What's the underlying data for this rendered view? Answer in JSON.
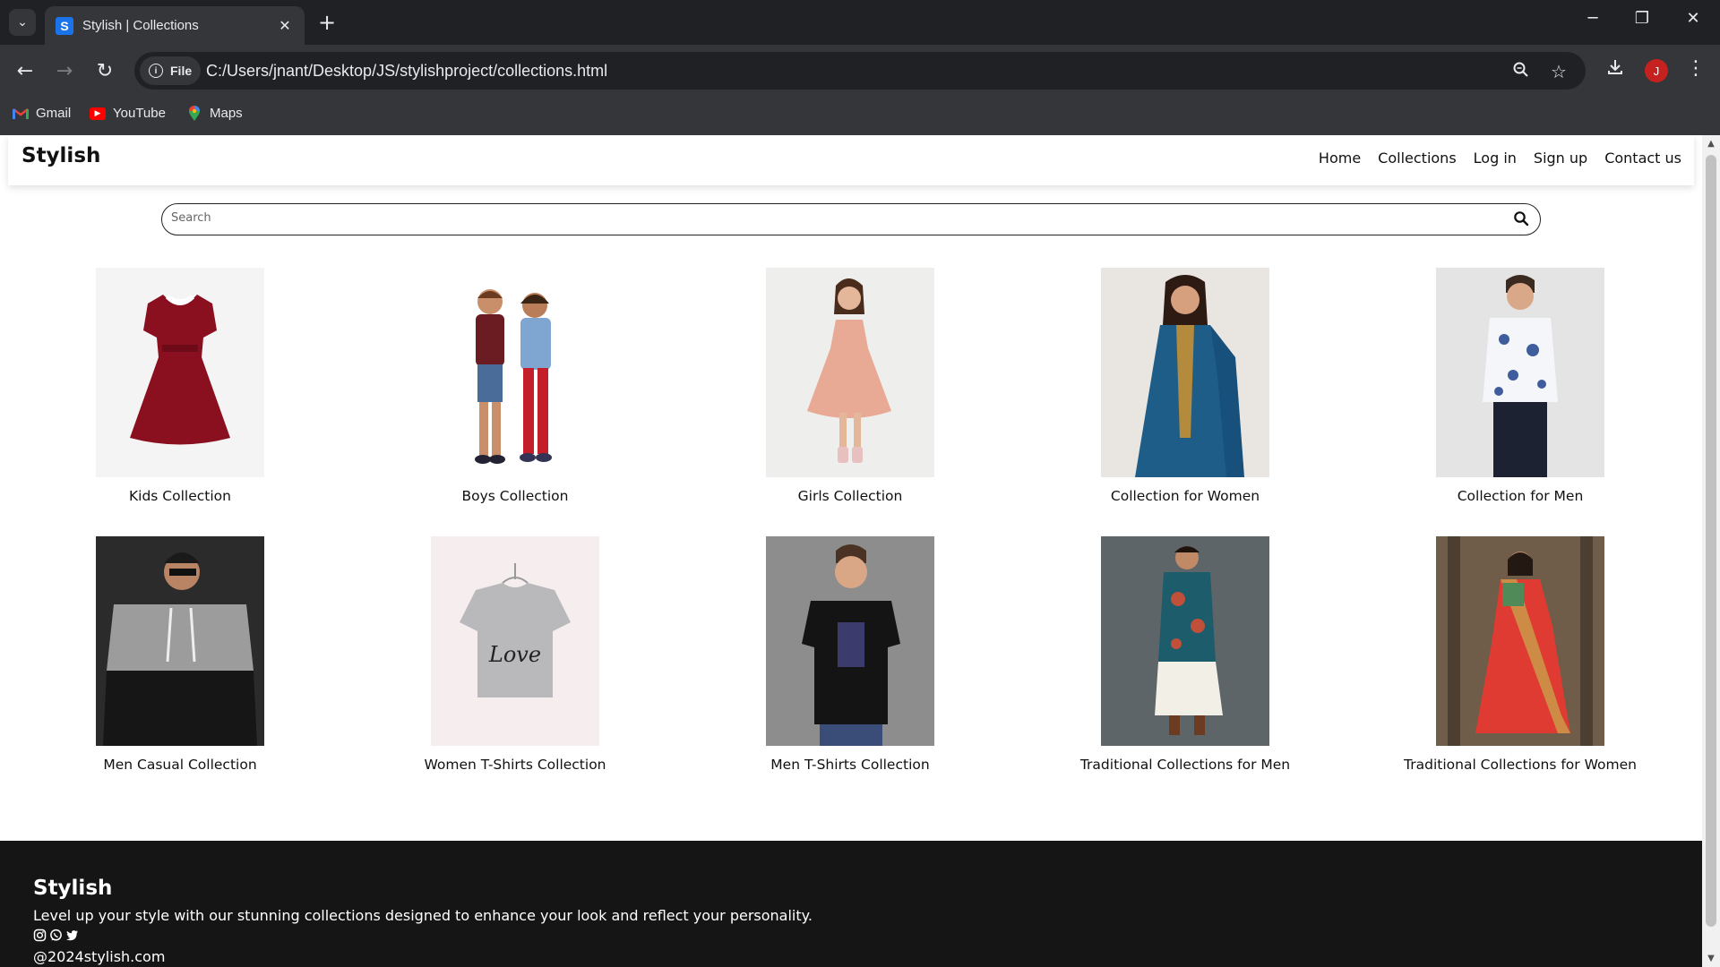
{
  "browser": {
    "tab_title": "Stylish | Collections",
    "favicon_letter": "S",
    "url_chip": "File",
    "url": "C:/Users/jnant/Desktop/JS/stylishproject/collections.html",
    "profile_initial": "J",
    "bookmarks": [
      {
        "label": "Gmail",
        "icon": "gmail-icon"
      },
      {
        "label": "YouTube",
        "icon": "youtube-icon"
      },
      {
        "label": "Maps",
        "icon": "maps-icon"
      }
    ]
  },
  "site": {
    "brand": "Stylish",
    "nav": [
      "Home",
      "Collections",
      "Log in",
      "Sign up",
      "Contact us"
    ],
    "search_placeholder": "Search",
    "collections": [
      {
        "label": "Kids Collection",
        "image": "red velvet kids dress"
      },
      {
        "label": "Boys Collection",
        "image": "two boys"
      },
      {
        "label": "Girls Collection",
        "image": "girl in pink sequin dress"
      },
      {
        "label": "Collection for Women",
        "image": "woman in blue kurta"
      },
      {
        "label": "Collection for Men",
        "image": "man in floral shirt"
      },
      {
        "label": "Men Casual Collection",
        "image": "man in hoodie"
      },
      {
        "label": "Women T-Shirts Collection",
        "image": "grey love t-shirt"
      },
      {
        "label": "Men T-Shirts Collection",
        "image": "man in black t-shirt"
      },
      {
        "label": "Traditional Collections for Men",
        "image": "man in sherwani"
      },
      {
        "label": "Traditional Collections for Women",
        "image": "woman in red saree"
      }
    ],
    "footer": {
      "brand": "Stylish",
      "tagline": "Level up your style with our stunning collections designed to enhance your look and reflect your personality.",
      "social": [
        "instagram-icon",
        "whatsapp-icon",
        "twitter-icon"
      ],
      "copyright": "@2024stylish.com"
    }
  },
  "colors": {
    "chrome_dark": "#202124",
    "chrome_mid": "#35363a",
    "footer_bg": "#151515",
    "accent_profile": "#c5221f"
  }
}
